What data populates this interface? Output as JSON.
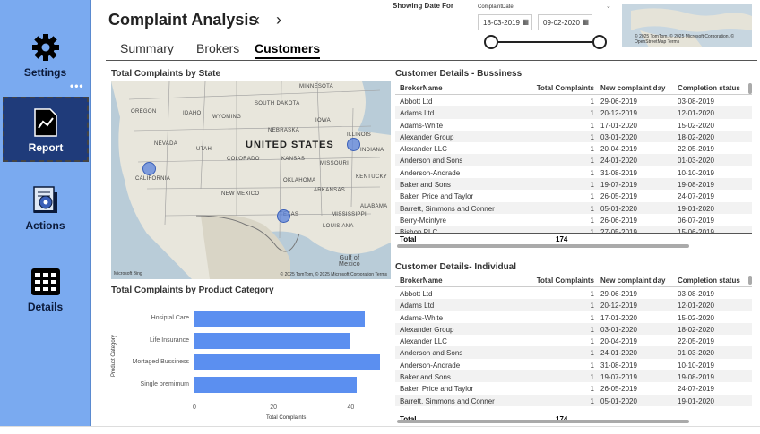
{
  "sidebar": {
    "items": [
      {
        "label": "Settings",
        "icon": "gear-icon"
      },
      {
        "label": "Report",
        "icon": "report-chart-icon"
      },
      {
        "label": "Actions",
        "icon": "actions-gear-document-icon"
      },
      {
        "label": "Details",
        "icon": "grid-details-icon"
      }
    ],
    "more": "•••"
  },
  "header": {
    "title": "Complaint Analysis",
    "prev": "‹",
    "next": "›",
    "tabs": [
      "Summary",
      "Brokers",
      "Customers"
    ],
    "active_tab": "Customers"
  },
  "date_filter": {
    "title": "Showing Date For",
    "field": "ComplaintDate",
    "start": "18-03-2019",
    "end": "09-02-2020",
    "calendar_icon": "▦"
  },
  "mini_map": {
    "attribution": "© 2025 TomTom, © 2025 Microsoft Corporation, © OpenStreetMap Terms"
  },
  "map_section": {
    "title": "Total Complaints by State",
    "labels": {
      "country": "UNITED STATES",
      "minnesota": "MINNESOTA",
      "south_dakota": "SOUTH DAKOTA",
      "oregon": "OREGON",
      "idaho": "IDAHO",
      "wyoming": "WYOMING",
      "iowa": "IOWA",
      "nebraska": "NEBRASKA",
      "illinois": "ILLINOIS",
      "nevada": "NEVADA",
      "utah": "UTAH",
      "colorado": "COLORADO",
      "kansas": "KANSAS",
      "missouri": "MISSOURI",
      "indiana": "INDIANA",
      "california": "CALIFORNIA",
      "kentucky": "KENTUCKY",
      "oklahoma": "OKLAHOMA",
      "new_mexico": "NEW MEXICO",
      "arkansas": "ARKANSAS",
      "texas": "TEXAS",
      "mississippi": "MISSISSIPPI",
      "alabama": "ALABAMA",
      "louisiana": "LOUISIANA",
      "gulf": "Gulf of\nMexico"
    },
    "logo": "Microsoft Bing",
    "attribution": "© 2025 TomTom, © 2025 Microsoft Corporation Terms"
  },
  "bar_section": {
    "title": "Total Complaints by Product Category"
  },
  "chart_data": {
    "type": "bar",
    "orientation": "horizontal",
    "categories": [
      "Hospital Care",
      "Life Insurance",
      "Mortaged Bussiness",
      "Single premimum"
    ],
    "category_labels": [
      "Hosiptal Care",
      "Life Insurance",
      "Mortaged Bussiness",
      "Single premimum"
    ],
    "values": [
      44,
      40,
      48,
      42
    ],
    "xlabel": "Total Complaints",
    "ylabel": "Product Category",
    "xlim": [
      0,
      48
    ],
    "xticks": [
      "0",
      "20",
      "40"
    ],
    "color": "#5b8ff0"
  },
  "business_table": {
    "title": "Customer Details - Bussiness",
    "columns": [
      "BrokerName",
      "Total Complaints",
      "New complaint day",
      "Completion status"
    ],
    "rows": [
      [
        "Abbott Ltd",
        "1",
        "29-06-2019",
        "03-08-2019"
      ],
      [
        "Adams Ltd",
        "1",
        "20-12-2019",
        "12-01-2020"
      ],
      [
        "Adams-White",
        "1",
        "17-01-2020",
        "15-02-2020"
      ],
      [
        "Alexander Group",
        "1",
        "03-01-2020",
        "18-02-2020"
      ],
      [
        "Alexander LLC",
        "1",
        "20-04-2019",
        "22-05-2019"
      ],
      [
        "Anderson and Sons",
        "1",
        "24-01-2020",
        "01-03-2020"
      ],
      [
        "Anderson-Andrade",
        "1",
        "31-08-2019",
        "10-10-2019"
      ],
      [
        "Baker and Sons",
        "1",
        "19-07-2019",
        "19-08-2019"
      ],
      [
        "Baker, Price and Taylor",
        "1",
        "26-05-2019",
        "24-07-2019"
      ],
      [
        "Barrett, Simmons and Conner",
        "1",
        "05-01-2020",
        "19-01-2020"
      ],
      [
        "Berry-Mcintyre",
        "1",
        "26-06-2019",
        "06-07-2019"
      ],
      [
        "Bishop PLC",
        "1",
        "27-05-2019",
        "15-06-2019"
      ]
    ],
    "total_label": "Total",
    "total_value": "174"
  },
  "individual_table": {
    "title": "Customer Details- Individual",
    "columns": [
      "BrokerName",
      "Total Complaints",
      "New complaint day",
      "Completion status"
    ],
    "rows": [
      [
        "Abbott Ltd",
        "1",
        "29-06-2019",
        "03-08-2019"
      ],
      [
        "Adams Ltd",
        "1",
        "20-12-2019",
        "12-01-2020"
      ],
      [
        "Adams-White",
        "1",
        "17-01-2020",
        "15-02-2020"
      ],
      [
        "Alexander Group",
        "1",
        "03-01-2020",
        "18-02-2020"
      ],
      [
        "Alexander LLC",
        "1",
        "20-04-2019",
        "22-05-2019"
      ],
      [
        "Anderson and Sons",
        "1",
        "24-01-2020",
        "01-03-2020"
      ],
      [
        "Anderson-Andrade",
        "1",
        "31-08-2019",
        "10-10-2019"
      ],
      [
        "Baker and Sons",
        "1",
        "19-07-2019",
        "19-08-2019"
      ],
      [
        "Baker, Price and Taylor",
        "1",
        "26-05-2019",
        "24-07-2019"
      ],
      [
        "Barrett, Simmons and Conner",
        "1",
        "05-01-2020",
        "19-01-2020"
      ]
    ],
    "total_label": "Total",
    "total_value": "174"
  }
}
